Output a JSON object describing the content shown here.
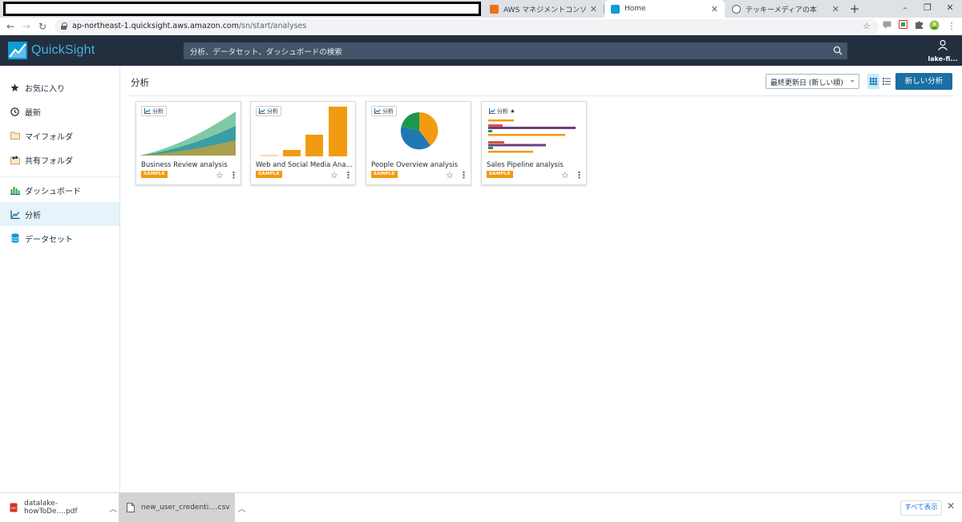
{
  "browser": {
    "tabs": [
      {
        "title": "AWS マネジメントコンソール",
        "close": "✕",
        "favicon_color": "#ec7211"
      },
      {
        "title": "Home",
        "close": "✕",
        "favicon_color": "#0f9bd7",
        "active": true
      },
      {
        "title": "テッキーメディアの本",
        "close": "✕",
        "favicon_color": "#5f6368"
      }
    ],
    "new_tab": "+",
    "window_controls": {
      "minimize": "–",
      "maximize": "❐",
      "close": "✕"
    },
    "nav": {
      "back": "←",
      "forward": "→",
      "reload": "↻"
    },
    "url_host": "ap-northeast-1.quicksight.aws.amazon.com",
    "url_path": "/sn/start/analyses",
    "extension_icons": [
      "star-icon",
      "chat-icon",
      "red-extension-icon",
      "green-extension-icon",
      "puzzle-icon",
      "profile-avatar",
      "kebab-menu-icon"
    ]
  },
  "header": {
    "logo_text": "QuickSight",
    "search_placeholder": "分析、データセット、ダッシュボードの検索",
    "user_name": "lake-fi..."
  },
  "sidebar": {
    "items": [
      {
        "label": "お気に入り",
        "icon": "star-icon"
      },
      {
        "label": "最新",
        "icon": "clock-icon"
      },
      {
        "label": "マイフォルダ",
        "icon": "folder-icon"
      },
      {
        "label": "共有フォルダ",
        "icon": "shared-folder-icon"
      },
      {
        "label": "ダッシュボード",
        "icon": "dashboard-icon"
      },
      {
        "label": "分析",
        "icon": "analysis-icon",
        "active": true
      },
      {
        "label": "データセット",
        "icon": "dataset-icon"
      }
    ]
  },
  "main": {
    "title": "分析",
    "sort_label": "最終更新日 (新しい順)",
    "new_button": "新しい分析",
    "cards": [
      {
        "title": "Business Review analysis",
        "badge": "分析",
        "sample": "SAMPLE"
      },
      {
        "title": "Web and Social Media Anal...",
        "badge": "分析",
        "sample": "SAMPLE"
      },
      {
        "title": "People Overview analysis",
        "badge": "分析",
        "sample": "SAMPLE"
      },
      {
        "title": "Sales Pipeline analysis",
        "badge": "分析 ★",
        "sample": "SAMPLE"
      }
    ],
    "star_glyph": "☆",
    "more_glyph": "⋮"
  },
  "downloads": {
    "items": [
      {
        "name": "datalake-howToDe....pdf",
        "type": "pdf"
      },
      {
        "name": "new_user_credenti....csv",
        "type": "csv"
      }
    ],
    "show_all": "すべて表示",
    "close": "✕"
  },
  "colors": {
    "header_bg": "#232f3e",
    "accent": "#0f9bd7",
    "primary_button": "#1a6fa3",
    "sample_badge": "#f29a11"
  }
}
